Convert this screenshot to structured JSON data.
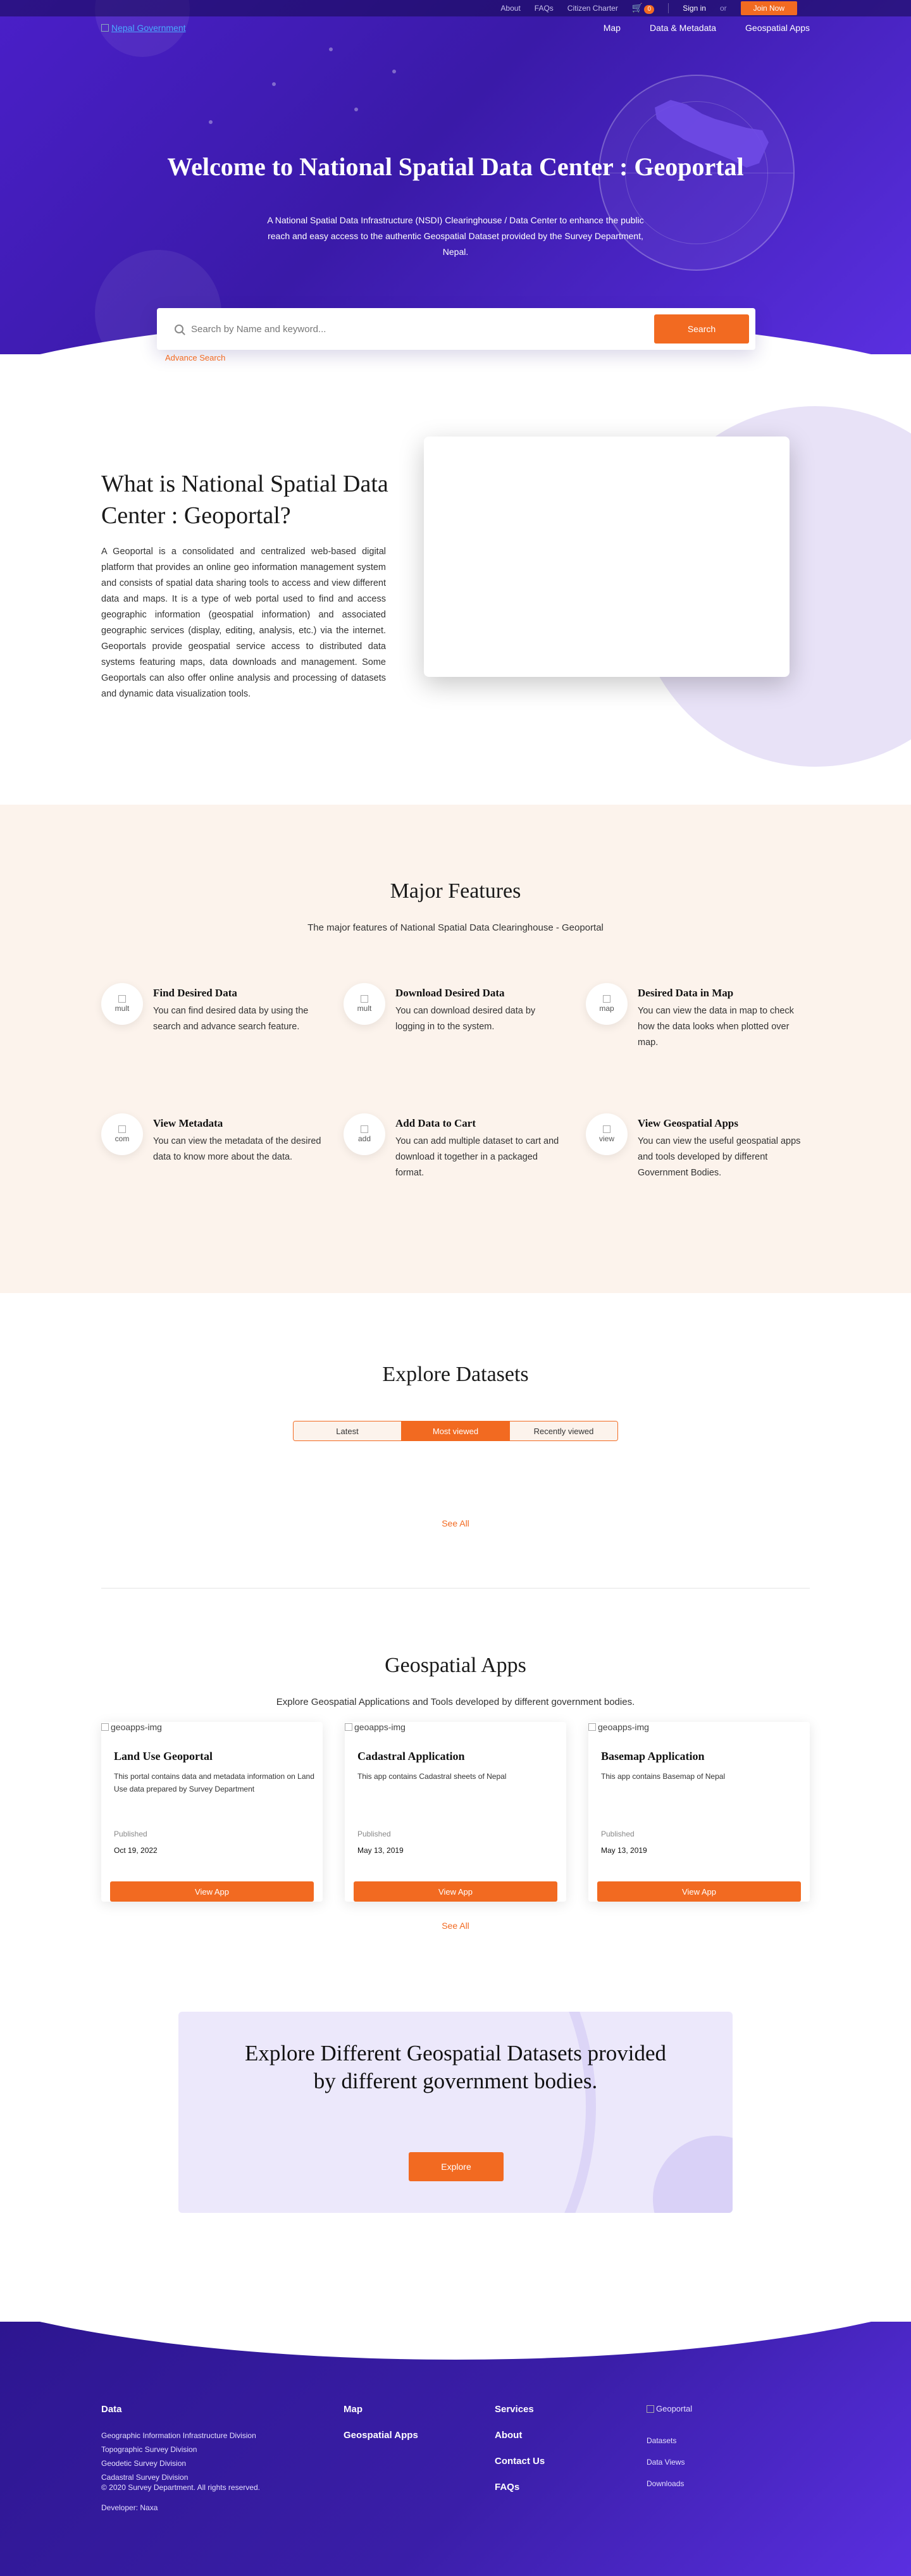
{
  "topbar": {
    "links": [
      "About",
      "FAQs",
      "Citizen Charter"
    ],
    "cart_count": "0",
    "signin": "Sign in",
    "or": "or",
    "join": "Join Now"
  },
  "nav": {
    "logo_alt": "Nepal Government",
    "links": [
      "Map",
      "Data & Metadata",
      "Geospatial Apps"
    ]
  },
  "hero": {
    "title": "Welcome to National Spatial Data Center : Geoportal",
    "description": "A National Spatial Data Infrastructure (NSDI) Clearinghouse / Data Center to enhance the public reach and easy access to the authentic Geospatial Dataset provided by the Survey Department, Nepal."
  },
  "search": {
    "placeholder": "Search by Name and keyword...",
    "button": "Search",
    "advanced": "Advance Search"
  },
  "about": {
    "title": "What is National Spatial Data Center : Geoportal?",
    "body": "A Geoportal is a consolidated and centralized web-based digital platform that provides an online geo information management system and consists of spatial data sharing tools to access and view different data and maps. It is a type of web portal used to find and access geographic information (geospatial information) and associated geographic services (display, editing, analysis, etc.) via the internet. Geoportals provide geospatial service access to distributed data systems featuring maps, data downloads and management. Some Geoportals can also offer online analysis and processing of datasets and dynamic data visualization tools."
  },
  "features": {
    "title": "Major Features",
    "subtitle": "The major features of National Spatial Data Clearinghouse - Geoportal",
    "items": [
      {
        "icon_alt": "mult",
        "title": "Find Desired Data",
        "desc": "You can find desired data by using the search and advance search feature."
      },
      {
        "icon_alt": "mult",
        "title": "Download Desired Data",
        "desc": "You can download desired data by logging in to the system."
      },
      {
        "icon_alt": "map",
        "title": "Desired Data in Map",
        "desc": "You can view the data in map to check how the data looks when plotted over map."
      },
      {
        "icon_alt": "com",
        "title": "View Metadata",
        "desc": "You can view the metadata of the desired data to know more about the data."
      },
      {
        "icon_alt": "add",
        "title": "Add Data to Cart",
        "desc": "You can add multiple dataset to cart and download it together in a packaged format."
      },
      {
        "icon_alt": "view",
        "title": "View Geospatial Apps",
        "desc": "You can view the useful geospatial apps and tools developed by different Government Bodies."
      }
    ]
  },
  "datasets": {
    "title": "Explore Datasets",
    "tabs": [
      "Latest",
      "Most viewed",
      "Recently viewed"
    ],
    "active_tab": "Most viewed",
    "see_all": "See All"
  },
  "apps": {
    "title": "Geospatial Apps",
    "subtitle": "Explore Geospatial Applications and Tools developed by different government bodies.",
    "img_alt": "geoapps-img",
    "published_label": "Published",
    "button": "View App",
    "see_all": "See All",
    "cards": [
      {
        "title": "Land Use Geoportal",
        "desc": "This portal contains data and metadata information on Land Use data prepared by Survey Department",
        "date": "Oct 19, 2022"
      },
      {
        "title": "Cadastral Application",
        "desc": "This app contains Cadastral sheets of Nepal",
        "date": "May 13, 2019"
      },
      {
        "title": "Basemap Application",
        "desc": "This app contains Basemap of Nepal",
        "date": "May 13, 2019"
      }
    ]
  },
  "cta": {
    "title": "Explore Different Geospatial Datasets provided by different government bodies.",
    "button": "Explore"
  },
  "footer": {
    "data_head": "Data",
    "data_items": [
      "Geographic Information Infrastructure Division",
      "Topographic Survey Division",
      "Geodetic Survey Division",
      "Cadastral Survey Division"
    ],
    "copyright": "© 2020 Survey Department. All rights reserved.",
    "developer": "Developer: Naxa",
    "col2": [
      "Map",
      "Geospatial Apps"
    ],
    "col3_head": "Services",
    "col3": [
      "About",
      "Contact Us",
      "FAQs"
    ],
    "logo_alt": "Geoportal",
    "col4": [
      "Datasets",
      "Data Views",
      "Downloads"
    ]
  },
  "colors": {
    "accent": "#f26a21",
    "hero": "#4a1fc8",
    "features_bg": "#fcf3ec"
  }
}
